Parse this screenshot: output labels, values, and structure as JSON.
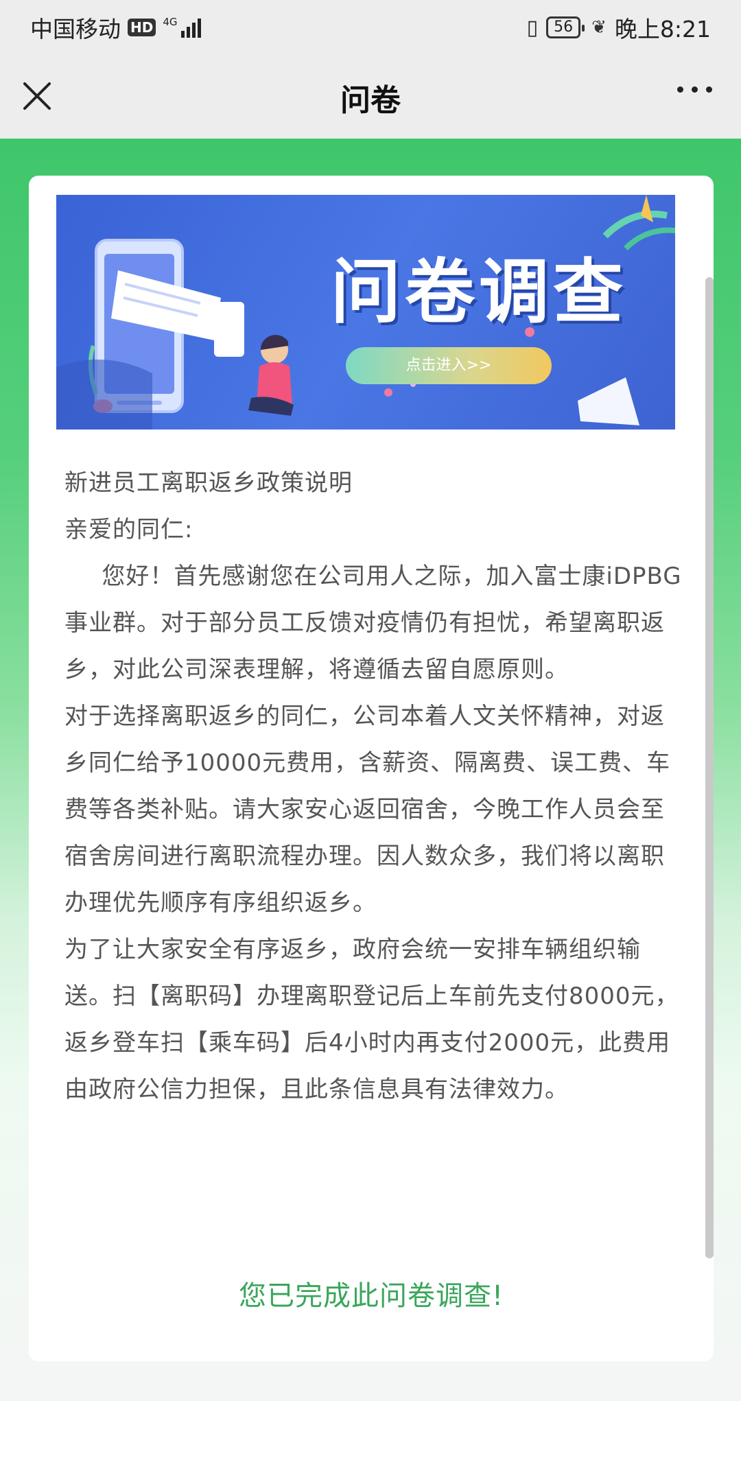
{
  "status_bar": {
    "carrier": "中国移动",
    "hd": "HD",
    "network": "4G",
    "battery": "56",
    "time": "晚上8:21"
  },
  "nav": {
    "title": "问卷"
  },
  "banner": {
    "title": "问卷调查",
    "cta": "点击进入>>"
  },
  "content": {
    "heading": "新进员工离职返乡政策说明",
    "greeting": "亲爱的同仁:",
    "paragraphs": [
      "您好！首先感谢您在公司用人之际，加入富士康iDPBG事业群。对于部分员工反馈对疫情仍有担忧，希望离职返乡，对此公司深表理解，将遵循去留自愿原则。",
      "对于选择离职返乡的同仁，公司本着人文关怀精神，对返乡同仁给予10000元费用，含薪资、隔离费、误工费、车费等各类补贴。请大家安心返回宿舍，今晚工作人员会至宿舍房间进行离职流程办理。因人数众多，我们将以离职办理优先顺序有序组织返乡。",
      "为了让大家安全有序返乡，政府会统一安排车辆组织输送。扫【离职码】办理离职登记后上车前先支付8000元，返乡登车扫【乘车码】后4小时内再支付2000元，此费用由政府公信力担保，且此条信息具有法律效力。"
    ],
    "completion": "您已完成此问卷调查!"
  },
  "colors": {
    "accent_green": "#3aa65b",
    "banner_blue": "#4a77e5"
  }
}
